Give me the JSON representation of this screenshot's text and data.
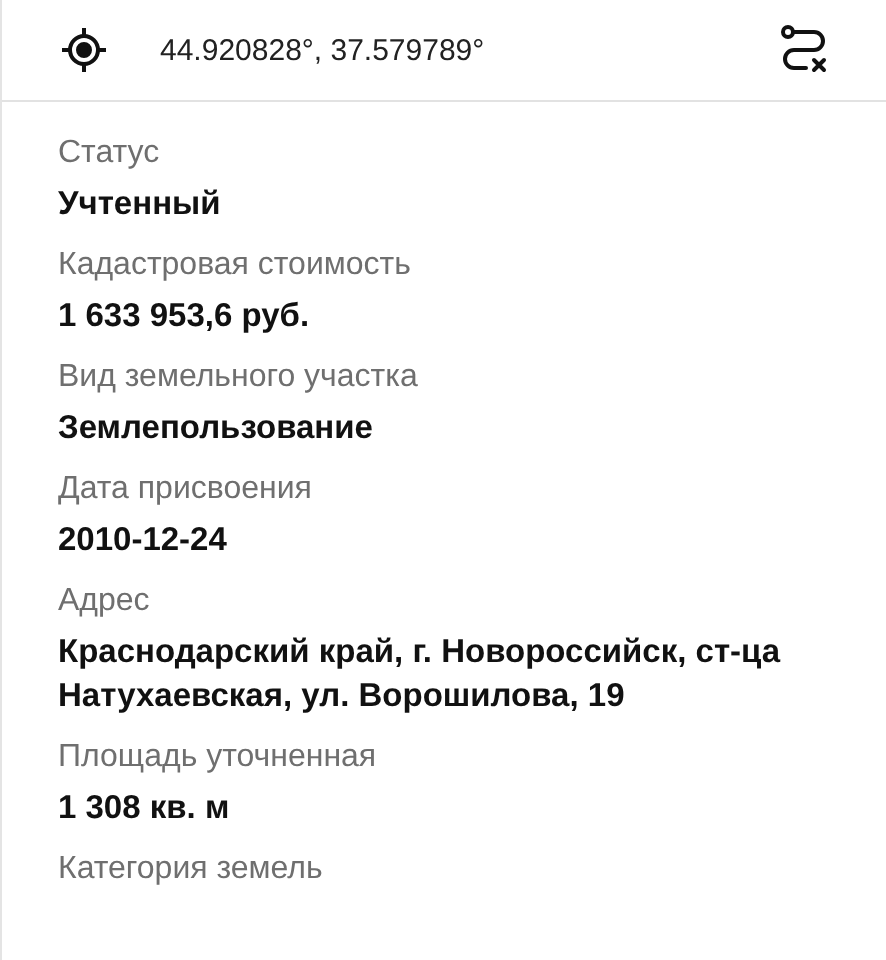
{
  "header": {
    "coordinates": "44.920828°, 37.579789°"
  },
  "fields": [
    {
      "label": "Статус",
      "value": "Учтенный"
    },
    {
      "label": "Кадастровая стоимость",
      "value": "1 633 953,6 руб."
    },
    {
      "label": "Вид земельного участка",
      "value": "Землепользование"
    },
    {
      "label": "Дата присвоения",
      "value": "2010-12-24"
    },
    {
      "label": "Адрес",
      "value": "Краснодарский край, г. Новороссийск, ст-ца Натухаевская, ул. Ворошилова, 19"
    },
    {
      "label": "Площадь уточненная",
      "value": "1 308 кв. м"
    },
    {
      "label": "Категория земель"
    }
  ]
}
